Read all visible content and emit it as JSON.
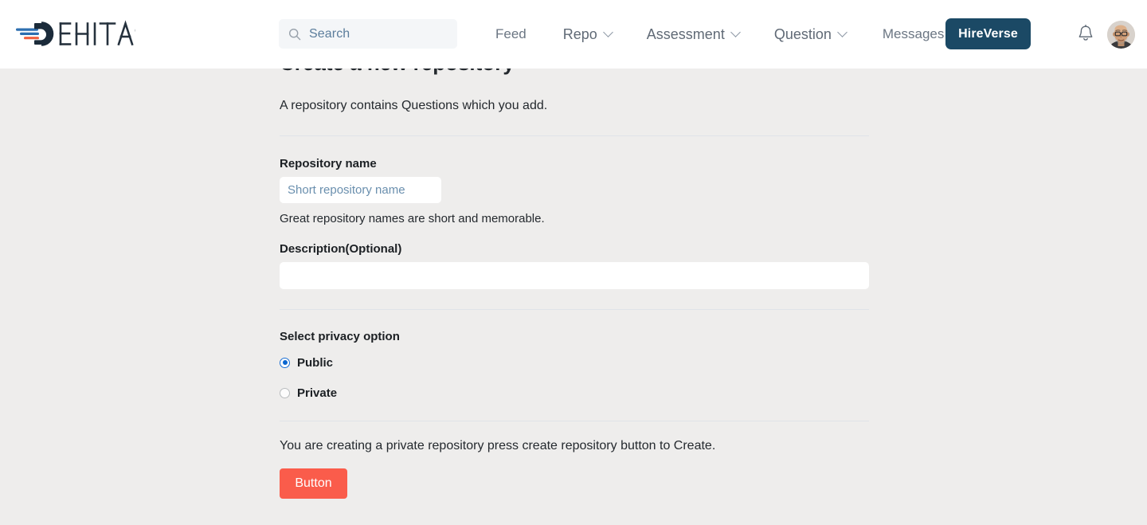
{
  "brand": {
    "name": "DEHITAS",
    "logo_mark_color": "#1b2b3a",
    "logo_accent_blue": "#2e6fb0",
    "logo_accent_orange": "#f2613f"
  },
  "header": {
    "search": {
      "placeholder": "Search",
      "value": ""
    },
    "nav": [
      {
        "label": "Feed",
        "has_chevron": false,
        "size": "sm"
      },
      {
        "label": "Repo",
        "has_chevron": true,
        "size": "lg"
      },
      {
        "label": "Assessment",
        "has_chevron": true,
        "size": "lg"
      },
      {
        "label": "Question",
        "has_chevron": true,
        "size": "lg"
      },
      {
        "label": "Messages",
        "has_chevron": false,
        "size": "sm"
      }
    ],
    "hireverse_button": {
      "label": "HireVerse",
      "bg_color": "#1b4965",
      "text_color": "#ffffff"
    },
    "notifications_icon": "bell-icon",
    "avatar_alt": "user-avatar"
  },
  "main": {
    "title": "Create a new repository",
    "subtitle": "A repository contains Questions which you add.",
    "repository_name": {
      "label": "Repository name",
      "placeholder": "Short repository name",
      "value": "",
      "helper": "Great repository names are short and memorable."
    },
    "description": {
      "label": "Description(Optional)",
      "placeholder": "",
      "value": ""
    },
    "privacy": {
      "label": "Select privacy option",
      "options": [
        {
          "label": "Public",
          "selected": true
        },
        {
          "label": "Private",
          "selected": false
        }
      ]
    },
    "status_text": "You are creating a private repository press create repository button to Create.",
    "submit_button": {
      "label": "Button",
      "bg_color": "#fa5c4b"
    }
  },
  "theme": {
    "page_background": "#eeedec",
    "header_background": "#ffffff",
    "divider_color": "#dfe3e8",
    "radio_selected_color": "#0a66d0",
    "placeholder_color": "#6a8fae"
  }
}
